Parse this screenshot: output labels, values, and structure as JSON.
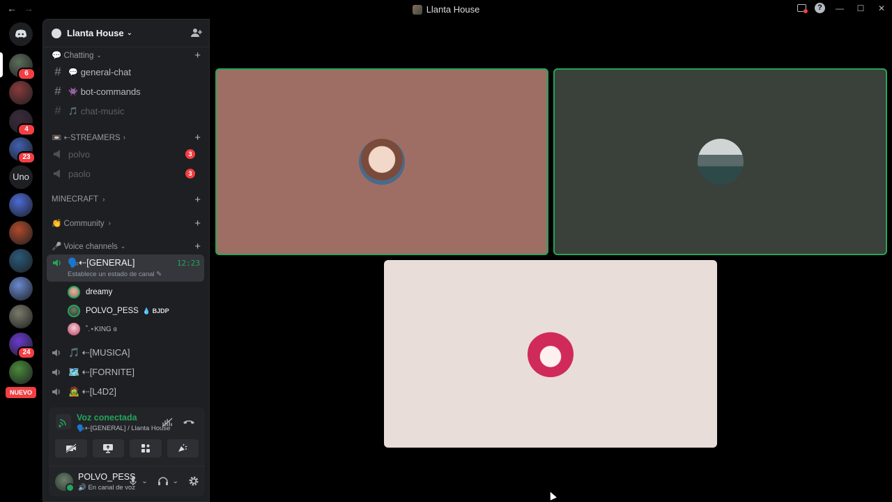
{
  "window": {
    "title": "Llanta House"
  },
  "guilds": {
    "items": [
      {
        "name": "server-1",
        "badge": "6",
        "color": "#5d6e5a"
      },
      {
        "name": "server-2",
        "badge": "",
        "color": "#8a3a3a"
      },
      {
        "name": "server-3",
        "badge": "4",
        "color": "#3a2a3a"
      },
      {
        "name": "server-4",
        "badge": "23",
        "color": "#4060b0"
      },
      {
        "name": "server-5",
        "text": "Uno"
      },
      {
        "name": "server-6",
        "badge": "",
        "color": "#4b6bd6"
      },
      {
        "name": "server-7",
        "badge": "",
        "color": "#b04a2a"
      },
      {
        "name": "server-8",
        "badge": "",
        "color": "#2a5a7a"
      },
      {
        "name": "server-9",
        "badge": "",
        "color": "#6a8ad0"
      },
      {
        "name": "server-10",
        "badge": "",
        "color": "#7a7a6a"
      },
      {
        "name": "server-11",
        "badge": "24",
        "color": "#6a3ad0"
      },
      {
        "name": "server-12",
        "badge": "",
        "color": "#4a8a3a"
      }
    ],
    "new_label": "NUEVO"
  },
  "sidebar": {
    "server_name": "Llanta House",
    "categories": {
      "chatting": "💬 Chatting",
      "streamers": "📼 ⇠STREAMERS",
      "minecraft": "MINECRAFT",
      "community": "👏 Community",
      "voice": "🎤 Voice channels"
    },
    "text_channels": [
      {
        "emoji": "💬",
        "label": "general-chat"
      },
      {
        "emoji": "👾",
        "label": "bot-commands"
      },
      {
        "emoji": "🎵",
        "label": "chat-music"
      }
    ],
    "streamer_channels": [
      {
        "label": "polvo",
        "unread": "3"
      },
      {
        "label": "paolo",
        "unread": "3"
      }
    ],
    "active_voice": {
      "name": "🗣️⇠[GENERAL]",
      "time": "12:23",
      "status": "Establece un estado de canal"
    },
    "voice_users": [
      {
        "name": "dreamy",
        "tag": ""
      },
      {
        "name": "POLVO_PESS",
        "tag": "💧 BJDP"
      },
      {
        "name": "˚.⋆KING ɞ",
        "tag": ""
      }
    ],
    "other_voice": [
      {
        "label": "🎵 ⇠[MUSICA]"
      },
      {
        "label": "🗺️ ⇠[FORNITE]"
      },
      {
        "label": "🧟 ⇠[L4D2]"
      }
    ]
  },
  "voice_panel": {
    "title": "Voz conectada",
    "subtitle": "🗣️⇠[GENERAL] / Llanta House"
  },
  "user": {
    "name": "POLVO_PESS",
    "status": "🔊 En canal de voz"
  },
  "tiles": [
    {
      "name": "dreamy",
      "bg": "#9e6e65",
      "speaking": true
    },
    {
      "name": "POLVO_PESS",
      "bg": "#3a403a",
      "speaking": true
    },
    {
      "name": "KING",
      "bg": "#e8ddd8",
      "speaking": false
    }
  ],
  "colors": {
    "accent_green": "#23a55a",
    "danger": "#f23f43"
  }
}
